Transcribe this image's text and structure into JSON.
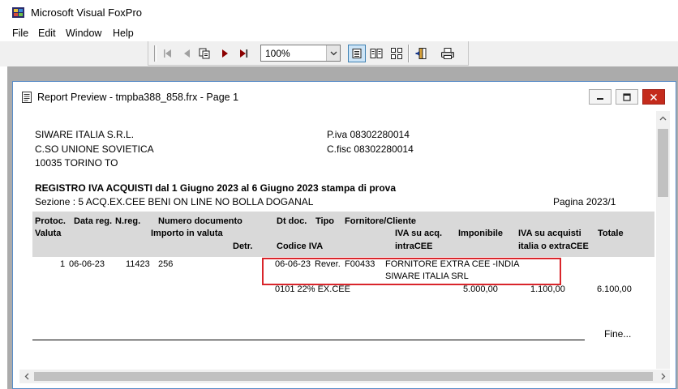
{
  "app": {
    "title": "Microsoft Visual FoxPro",
    "menu": [
      "File",
      "Edit",
      "Window",
      "Help"
    ]
  },
  "toolbar": {
    "zoom": "100%",
    "buttons": [
      "first-page-icon",
      "prev-page-icon",
      "goto-page-icon",
      "next-page-icon",
      "last-page-icon",
      "one-page-icon",
      "two-pages-icon",
      "four-pages-icon",
      "close-preview-icon",
      "print-icon"
    ]
  },
  "preview": {
    "title": "Report Preview - tmpba388_858.frx - Page 1"
  },
  "report": {
    "company": {
      "name": "SIWARE ITALIA S.R.L.",
      "address": "C.SO UNIONE SOVIETICA",
      "city": "10035  TORINO  TO",
      "piva": "P.iva  08302280014",
      "cfisc": "C.fisc 08302280014"
    },
    "title": "REGISTRO IVA ACQUISTI dal 1 Giugno 2023 al 6 Giugno 2023 stampa di prova",
    "section": "Sezione : 5 ACQ.EX.CEE BENI ON LINE NO BOLLA DOGANAL",
    "page": "Pagina 2023/1",
    "columns": {
      "protoc": "Protoc.",
      "valuta": "Valuta",
      "data_reg": "Data reg.",
      "n_reg": "N.reg.",
      "numero_doc": "Numero documento",
      "importo_valuta": "Importo in valuta",
      "detr": "Detr.",
      "dt_doc": "Dt doc.",
      "tipo": "Tipo",
      "fornitore": "Fornitore/Cliente",
      "codice_iva": "Codice IVA",
      "iva_acq_1": "IVA su acq.",
      "iva_acq_2": "intraCEE",
      "imponibile": "Imponibile",
      "iva_italia_1": "IVA su acquisti",
      "iva_italia_2": "italia o extraCEE",
      "totale": "Totale"
    },
    "row": {
      "protoc": "1",
      "data_reg": "06-06-23",
      "n_reg": "11423",
      "numero_doc": "256",
      "dt_doc": "06-06-23",
      "tipo": "Rever.",
      "fornitore_code": "F00433",
      "fornitore_name": "FORNITORE EXTRA CEE -INDIA",
      "fornitore_name2": "SIWARE ITALIA SRL",
      "codice_iva": "0101  22% EX.CEE",
      "imponibile": "5.000,00",
      "iva_italia": "1.100,00",
      "totale": "6.100,00"
    },
    "fine": "Fine..."
  }
}
